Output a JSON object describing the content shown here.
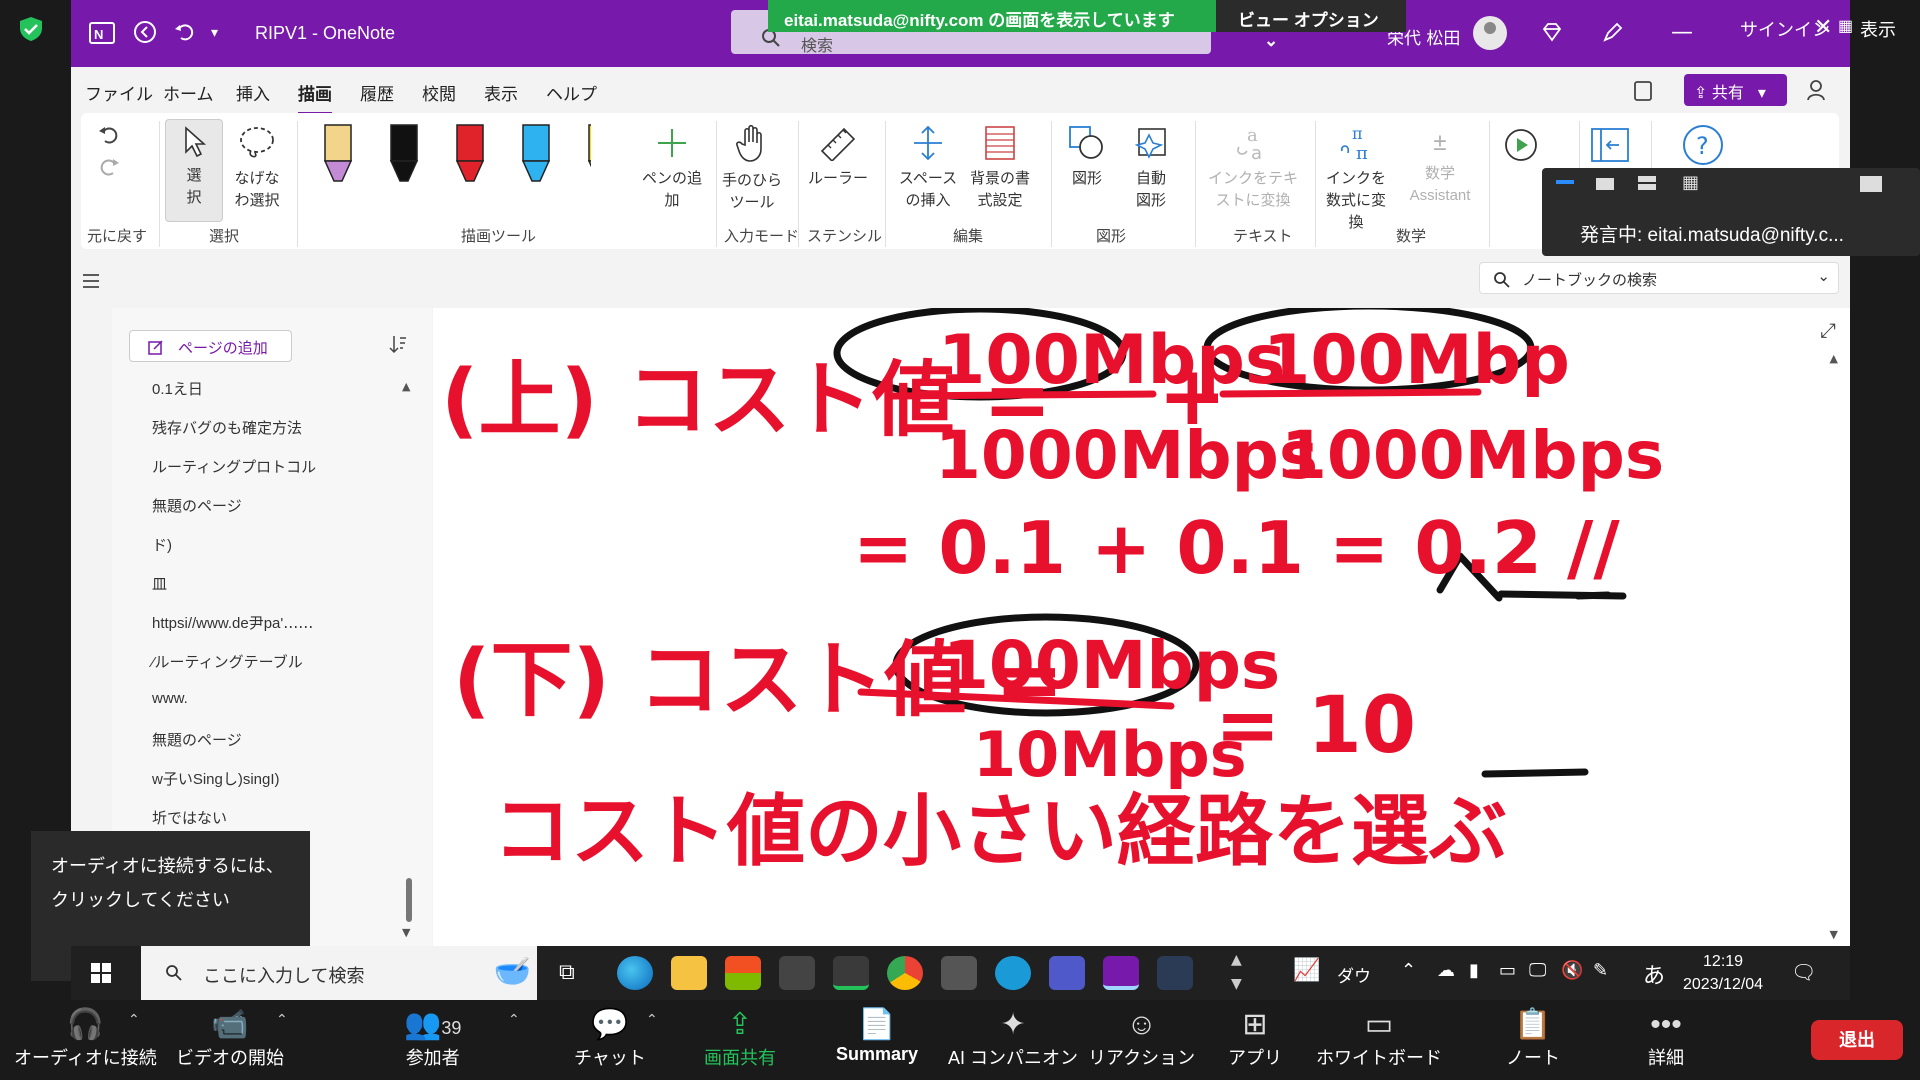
{
  "zoom": {
    "share_banner": "eitai.matsuda@nifty.com の画面を表示しています",
    "view_options": "ビュー オプション",
    "signin": "サインイン",
    "view_label": "表示",
    "speaker": "発言中: eitai.matsuda@nifty.c...",
    "audio_tip": "オーディオに接続するには、クリックしてください",
    "participants_count": "39",
    "leave": "退出",
    "toolbar": [
      {
        "label": "オーディオに接続",
        "icon": "headphones-icon"
      },
      {
        "label": "ビデオの開始",
        "icon": "video-off-icon"
      },
      {
        "label": "参加者",
        "icon": "participants-icon"
      },
      {
        "label": "チャット",
        "icon": "chat-icon"
      },
      {
        "label": "画面共有",
        "icon": "share-screen-icon"
      },
      {
        "label": "Summary",
        "icon": "summary-icon"
      },
      {
        "label": "AI コンパニオン",
        "icon": "ai-companion-icon"
      },
      {
        "label": "リアクション",
        "icon": "reaction-icon"
      },
      {
        "label": "アプリ",
        "icon": "apps-icon"
      },
      {
        "label": "ホワイトボード",
        "icon": "whiteboard-icon"
      },
      {
        "label": "ノート",
        "icon": "notes-icon"
      },
      {
        "label": "詳細",
        "icon": "more-icon"
      }
    ]
  },
  "onenote": {
    "title": "RIPV1 - OneNote",
    "search_placeholder": "検索",
    "user": "栄代 松田",
    "menu": [
      "ファイル",
      "ホーム",
      "挿入",
      "描画",
      "履歴",
      "校閲",
      "表示",
      "ヘルプ"
    ],
    "active_menu": "描画",
    "share_label": "共有",
    "ribbon": {
      "buttons": [
        "選択",
        "なげなわ選択",
        "ペンの追加",
        "手のひらツール",
        "ルーラー",
        "スペースの挿入",
        "背景の書式設定",
        "図形",
        "自動図形",
        "インクをテキストに変換",
        "インクを数式に変換",
        "数学 Assistant"
      ],
      "groups": [
        "元に戻す",
        "選択",
        "描画ツール",
        "入力モード",
        "ステンシル",
        "編集",
        "図形",
        "テキスト",
        "数学"
      ],
      "pen_colors": [
        "#f2d58b",
        "#111111",
        "#e0222b",
        "#2fb2f0",
        "#f3e21a"
      ]
    },
    "notebook_search": "ノートブックの検索",
    "add_page": "ページの追加",
    "pages": [
      "0.1え日",
      "残存バグのも確定方法",
      "ルーティングプロトコル",
      "無題のページ",
      "ド)",
      "皿",
      "httpsi//www.de尹pa'‥‥‥",
      "⁄ルーティングテーブル",
      "www.",
      "無題のページ",
      "w子いSingし)singI)",
      "圻ではない"
    ],
    "ink_color": "#e8112d"
  },
  "taskbar": {
    "search": "ここに入力して検索",
    "weather": "ダウ",
    "ime": "あ",
    "time": "12:19",
    "date": "2023/12/04"
  }
}
